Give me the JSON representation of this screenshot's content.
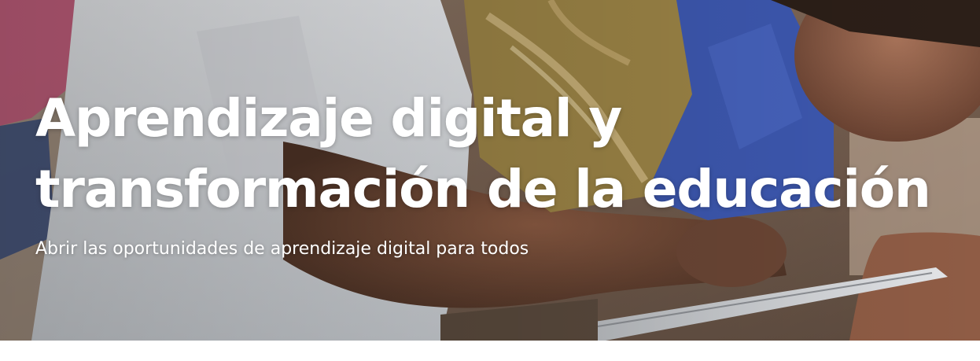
{
  "hero": {
    "title_line_1": "Aprendizaje digital y",
    "title_line_2": "transformación de la educación",
    "subtitle": "Abrir las oportunidades de aprendizaje digital para todos",
    "text_color": "#ffffff",
    "image_description": "photo"
  }
}
